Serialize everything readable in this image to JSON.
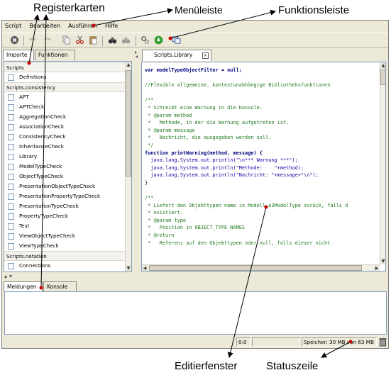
{
  "annotations": {
    "tabs_label": "Registerkarten",
    "menu_label": "Menüleiste",
    "toolbar_label": "Funktionsleiste",
    "editor_label": "Editierfenster",
    "status_label": "Statuszeile"
  },
  "menu": [
    "Script",
    "Bearbeiten",
    "Ausführen",
    "Hilfe"
  ],
  "left_tabs": [
    "Importe",
    "Funktionen"
  ],
  "tree": {
    "group1": "Scripts",
    "group1_items": [
      "Definitions"
    ],
    "group2": "Scripts.consistency",
    "group2_items": [
      "APT",
      "APTCheck",
      "AggregationCheck",
      "AssociationCheck",
      "ConsistencyCheck",
      "InheritanceCheck",
      "Library",
      "ModelTypeCheck",
      "ObjectTypeCheck",
      "PresentationObjectTypeCheck",
      "PresentationPropertyTypeCheck",
      "PresentationTypeCheck",
      "PropertyTypeCheck",
      "Test",
      "ViewObjectTypeCheck",
      "ViewTypeCheck"
    ],
    "group3": "Scripts.notation",
    "group3_items": [
      "Connections"
    ]
  },
  "editor": {
    "tab_label": "Scripts.Library",
    "close_glyph": "×",
    "code": [
      [
        "kw",
        "var modelTypeObjectFilter = null;"
      ],
      [
        "pl",
        ""
      ],
      [
        "cm",
        "//Flexible allgemeine, kontextunabhängige Bibliotheksfunktionen"
      ],
      [
        "pl",
        ""
      ],
      [
        "cm",
        "/**"
      ],
      [
        "cm",
        " * Schreibt eine Warnung in die Konsole."
      ],
      [
        "cm",
        " * @param method"
      ],
      [
        "cm",
        " *   Methode, in der die Warnung aufgetreten ist."
      ],
      [
        "cm",
        " * @param message"
      ],
      [
        "cm",
        " *   Nachricht, die ausgegeben werden soll."
      ],
      [
        "cm",
        " */"
      ],
      [
        "kw",
        "function printWarning(method, message) {"
      ],
      [
        "st",
        "  java.lang.System.out.println(\"\\n*** Warnung ***\");"
      ],
      [
        "st",
        "  java.lang.System.out.println(\"Methode:    \"+method);"
      ],
      [
        "st",
        "  java.lang.System.out.println(\"Nachricht: \"+message+\"\\n\");"
      ],
      [
        "pl",
        "}"
      ],
      [
        "pl",
        ""
      ],
      [
        "cm",
        "/**"
      ],
      [
        "cm",
        " * Liefert den Objekttypen name in Modell e3ModelType zurück, falls d"
      ],
      [
        "cm",
        " * existiert."
      ],
      [
        "cm",
        " * @param type"
      ],
      [
        "cm",
        " *   Position in OBJECT_TYPE_NAMES"
      ],
      [
        "cm",
        " * @return"
      ],
      [
        "cm",
        " *   Referenz auf den Objekttypen oder null, falls dieser nicht"
      ]
    ]
  },
  "bottom_tabs": [
    "Meldungen",
    "Konsole"
  ],
  "status": {
    "position": "0:0",
    "memory": "Speicher: 30 MB  von 63 MB"
  },
  "colors": {
    "accent_annotation_dot": "#c80000",
    "comment": "#1f7a1f",
    "keyword": "#000080",
    "string": "#2a00a5"
  },
  "icons": [
    "stop-icon",
    "undo-icon",
    "redo-icon",
    "copy-icon",
    "cut-icon",
    "paste-icon",
    "find-icon",
    "find-next-icon",
    "settings-icon",
    "run-icon",
    "windows-icon",
    "trash-icon"
  ]
}
